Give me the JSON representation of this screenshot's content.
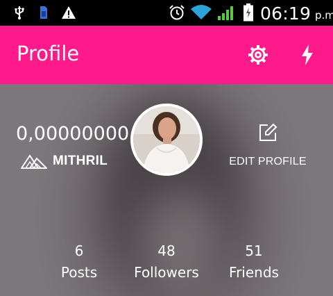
{
  "status_bar": {
    "time": "06:19",
    "ampm": "p.m.",
    "icons": [
      "usb-icon",
      "sim-card-icon",
      "warning-icon",
      "alarm-icon",
      "wifi-icon",
      "signal-icon",
      "battery-icon"
    ]
  },
  "app_bar": {
    "title": "Profile",
    "background": "#ff1a8c",
    "actions": [
      "settings-icon",
      "lightning-icon"
    ]
  },
  "profile": {
    "balance": "0,00000000",
    "currency_label": "MITHRIL",
    "edit_label": "EDIT PROFILE",
    "stats": [
      {
        "value": "6",
        "label": "Posts"
      },
      {
        "value": "48",
        "label": "Followers"
      },
      {
        "value": "51",
        "label": "Friends"
      }
    ]
  }
}
